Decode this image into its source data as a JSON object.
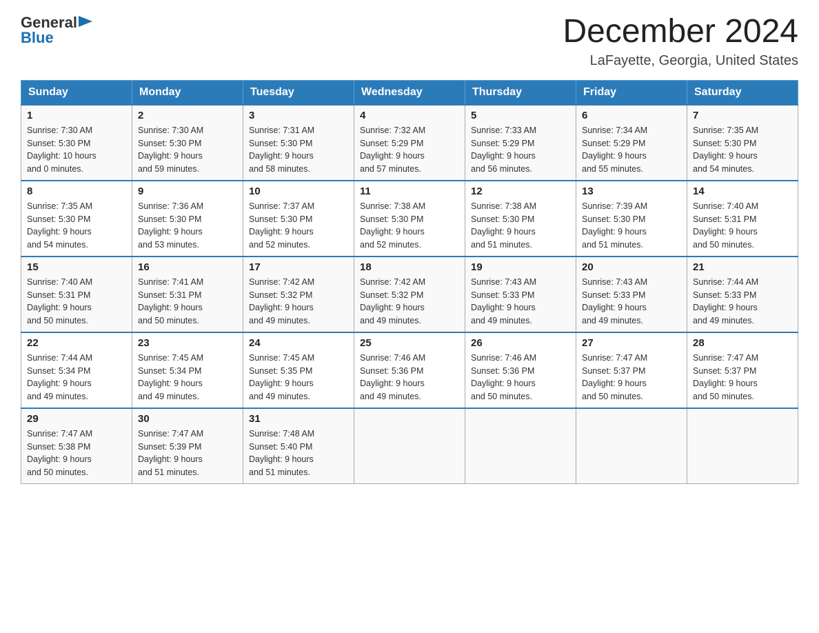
{
  "header": {
    "logo_general": "General",
    "logo_blue": "Blue",
    "month_title": "December 2024",
    "location": "LaFayette, Georgia, United States"
  },
  "days_of_week": [
    "Sunday",
    "Monday",
    "Tuesday",
    "Wednesday",
    "Thursday",
    "Friday",
    "Saturday"
  ],
  "weeks": [
    [
      {
        "day": "1",
        "sunrise": "7:30 AM",
        "sunset": "5:30 PM",
        "daylight_hours": "10",
        "daylight_minutes": "0"
      },
      {
        "day": "2",
        "sunrise": "7:30 AM",
        "sunset": "5:30 PM",
        "daylight_hours": "9",
        "daylight_minutes": "59"
      },
      {
        "day": "3",
        "sunrise": "7:31 AM",
        "sunset": "5:30 PM",
        "daylight_hours": "9",
        "daylight_minutes": "58"
      },
      {
        "day": "4",
        "sunrise": "7:32 AM",
        "sunset": "5:29 PM",
        "daylight_hours": "9",
        "daylight_minutes": "57"
      },
      {
        "day": "5",
        "sunrise": "7:33 AM",
        "sunset": "5:29 PM",
        "daylight_hours": "9",
        "daylight_minutes": "56"
      },
      {
        "day": "6",
        "sunrise": "7:34 AM",
        "sunset": "5:29 PM",
        "daylight_hours": "9",
        "daylight_minutes": "55"
      },
      {
        "day": "7",
        "sunrise": "7:35 AM",
        "sunset": "5:30 PM",
        "daylight_hours": "9",
        "daylight_minutes": "54"
      }
    ],
    [
      {
        "day": "8",
        "sunrise": "7:35 AM",
        "sunset": "5:30 PM",
        "daylight_hours": "9",
        "daylight_minutes": "54"
      },
      {
        "day": "9",
        "sunrise": "7:36 AM",
        "sunset": "5:30 PM",
        "daylight_hours": "9",
        "daylight_minutes": "53"
      },
      {
        "day": "10",
        "sunrise": "7:37 AM",
        "sunset": "5:30 PM",
        "daylight_hours": "9",
        "daylight_minutes": "52"
      },
      {
        "day": "11",
        "sunrise": "7:38 AM",
        "sunset": "5:30 PM",
        "daylight_hours": "9",
        "daylight_minutes": "52"
      },
      {
        "day": "12",
        "sunrise": "7:38 AM",
        "sunset": "5:30 PM",
        "daylight_hours": "9",
        "daylight_minutes": "51"
      },
      {
        "day": "13",
        "sunrise": "7:39 AM",
        "sunset": "5:30 PM",
        "daylight_hours": "9",
        "daylight_minutes": "51"
      },
      {
        "day": "14",
        "sunrise": "7:40 AM",
        "sunset": "5:31 PM",
        "daylight_hours": "9",
        "daylight_minutes": "50"
      }
    ],
    [
      {
        "day": "15",
        "sunrise": "7:40 AM",
        "sunset": "5:31 PM",
        "daylight_hours": "9",
        "daylight_minutes": "50"
      },
      {
        "day": "16",
        "sunrise": "7:41 AM",
        "sunset": "5:31 PM",
        "daylight_hours": "9",
        "daylight_minutes": "50"
      },
      {
        "day": "17",
        "sunrise": "7:42 AM",
        "sunset": "5:32 PM",
        "daylight_hours": "9",
        "daylight_minutes": "49"
      },
      {
        "day": "18",
        "sunrise": "7:42 AM",
        "sunset": "5:32 PM",
        "daylight_hours": "9",
        "daylight_minutes": "49"
      },
      {
        "day": "19",
        "sunrise": "7:43 AM",
        "sunset": "5:33 PM",
        "daylight_hours": "9",
        "daylight_minutes": "49"
      },
      {
        "day": "20",
        "sunrise": "7:43 AM",
        "sunset": "5:33 PM",
        "daylight_hours": "9",
        "daylight_minutes": "49"
      },
      {
        "day": "21",
        "sunrise": "7:44 AM",
        "sunset": "5:33 PM",
        "daylight_hours": "9",
        "daylight_minutes": "49"
      }
    ],
    [
      {
        "day": "22",
        "sunrise": "7:44 AM",
        "sunset": "5:34 PM",
        "daylight_hours": "9",
        "daylight_minutes": "49"
      },
      {
        "day": "23",
        "sunrise": "7:45 AM",
        "sunset": "5:34 PM",
        "daylight_hours": "9",
        "daylight_minutes": "49"
      },
      {
        "day": "24",
        "sunrise": "7:45 AM",
        "sunset": "5:35 PM",
        "daylight_hours": "9",
        "daylight_minutes": "49"
      },
      {
        "day": "25",
        "sunrise": "7:46 AM",
        "sunset": "5:36 PM",
        "daylight_hours": "9",
        "daylight_minutes": "49"
      },
      {
        "day": "26",
        "sunrise": "7:46 AM",
        "sunset": "5:36 PM",
        "daylight_hours": "9",
        "daylight_minutes": "50"
      },
      {
        "day": "27",
        "sunrise": "7:47 AM",
        "sunset": "5:37 PM",
        "daylight_hours": "9",
        "daylight_minutes": "50"
      },
      {
        "day": "28",
        "sunrise": "7:47 AM",
        "sunset": "5:37 PM",
        "daylight_hours": "9",
        "daylight_minutes": "50"
      }
    ],
    [
      {
        "day": "29",
        "sunrise": "7:47 AM",
        "sunset": "5:38 PM",
        "daylight_hours": "9",
        "daylight_minutes": "50"
      },
      {
        "day": "30",
        "sunrise": "7:47 AM",
        "sunset": "5:39 PM",
        "daylight_hours": "9",
        "daylight_minutes": "51"
      },
      {
        "day": "31",
        "sunrise": "7:48 AM",
        "sunset": "5:40 PM",
        "daylight_hours": "9",
        "daylight_minutes": "51"
      },
      null,
      null,
      null,
      null
    ]
  ],
  "labels": {
    "sunrise": "Sunrise:",
    "sunset": "Sunset:",
    "daylight": "Daylight:"
  }
}
